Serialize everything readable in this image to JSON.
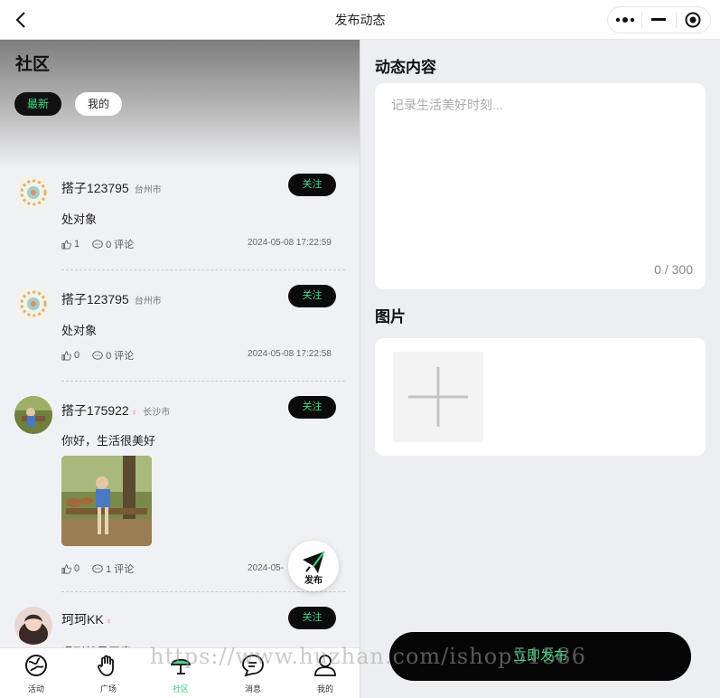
{
  "topbar": {
    "title": "发布动态",
    "back_icon": "chevron-left-icon",
    "more_icon": "more-dots-icon",
    "minimize_icon": "minimize-icon",
    "close_icon": "target-close-icon"
  },
  "community": {
    "title": "社区",
    "tabs": [
      {
        "label": "最新",
        "active": true
      },
      {
        "label": "我的",
        "active": false
      }
    ],
    "follow_label": "关注",
    "fab_label": "发布",
    "posts": [
      {
        "name": "搭子123795",
        "city": "台州市",
        "text": "处对象",
        "likes": "1",
        "comments": "0 评论",
        "time": "2024-05-08 17:22:59"
      },
      {
        "name": "搭子123795",
        "city": "台州市",
        "text": "处对象",
        "likes": "0",
        "comments": "0 评论",
        "time": "2024-05-08 17:22:58"
      },
      {
        "name": "搭子175922",
        "city": "长沙市",
        "text": "你好，生活很美好",
        "likes": "0",
        "comments": "1 评论",
        "time": "2024-05-"
      },
      {
        "name": "珂珂KK",
        "city": "",
        "text": "遇到就是无意",
        "likes": "",
        "comments": "",
        "time": ""
      }
    ]
  },
  "tabbar": {
    "items": [
      {
        "label": "活动",
        "icon": "globe-icon",
        "active": false
      },
      {
        "label": "广场",
        "icon": "hand-icon",
        "active": false
      },
      {
        "label": "社区",
        "icon": "umbrella-icon",
        "active": true
      },
      {
        "label": "消息",
        "icon": "message-icon",
        "active": false
      },
      {
        "label": "我的",
        "icon": "user-icon",
        "active": false
      }
    ]
  },
  "publish": {
    "content_title": "动态内容",
    "content_placeholder": "记录生活美好时刻...",
    "content_value": "",
    "counter": "0 / 300",
    "image_title": "图片",
    "submit_label": "立即发布"
  },
  "watermark": "https://www.huzhan.com/ishop51586",
  "colors": {
    "accent": "#3ddc84",
    "dark": "#0b0b0b",
    "bg": "#eceef2"
  }
}
